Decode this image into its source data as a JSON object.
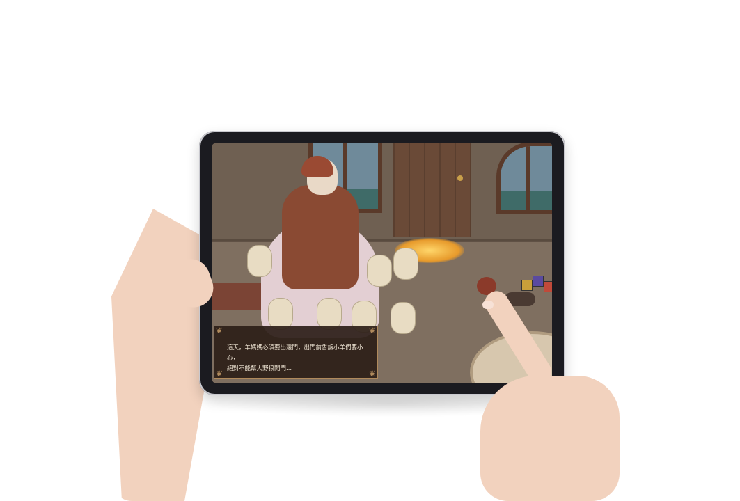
{
  "storybook": {
    "dialogue_lines": [
      "這天，羊媽媽必須要出遠門，出門前告訴小羊們要小心，",
      "絕對不能幫大野狼開門..."
    ],
    "dialogue_text": "這天，羊媽媽必須要出遠門，出門前告訴小羊們要小心，\n絕對不能幫大野狼開門..."
  },
  "colors": {
    "background": "#ffffff",
    "tablet_bezel": "#1b1b20",
    "dialog_bg": "#2c1e18",
    "dialog_border": "#b08a5c",
    "dialog_text": "#f3e9d8",
    "scene_wall": "#6f6052",
    "scene_floor": "#7f6f60"
  },
  "icons": [
    "ornament-corner-icon"
  ]
}
